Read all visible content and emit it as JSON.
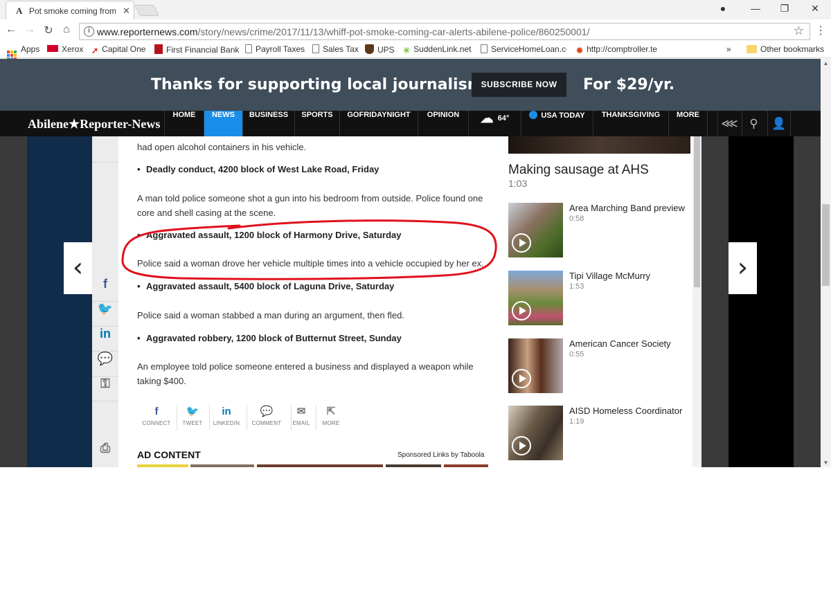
{
  "browser": {
    "tab_title": "Pot smoke coming from",
    "tab_favicon": "A",
    "url_domain": "www.reporternews.com",
    "url_path": "/story/news/crime/2017/11/13/whiff-pot-smoke-coming-car-alerts-abilene-police/860250001/",
    "bookmarks": [
      {
        "label": "Apps",
        "icon": "apps-grid-icon"
      },
      {
        "label": "Xerox",
        "icon": "xerox-icon",
        "color": "#d4002a"
      },
      {
        "label": "Capital One",
        "icon": "capital-one-icon",
        "color": "#d03027"
      },
      {
        "label": "First Financial Bank",
        "icon": "ffb-icon",
        "color": "#b5121b"
      },
      {
        "label": "Payroll Taxes",
        "icon": "page-icon"
      },
      {
        "label": "Sales Tax",
        "icon": "page-icon"
      },
      {
        "label": "UPS",
        "icon": "ups-icon",
        "color": "#5a3a1c"
      },
      {
        "label": "SuddenLink.net",
        "icon": "suddenlink-icon",
        "color": "#7fc241"
      },
      {
        "label": "ServiceHomeLoan.co",
        "icon": "page-icon"
      },
      {
        "label": "http://comptroller.te",
        "icon": "comptroller-icon",
        "color": "#d84a1b"
      }
    ],
    "overflow_label": "»",
    "other_bookmarks": "Other bookmarks"
  },
  "promo": {
    "left_text": "Thanks for supporting local journalism",
    "button": "SUBSCRIBE NOW",
    "right_text": "For $29/yr."
  },
  "site_nav": {
    "brand": "Abilene★Reporter-News",
    "items": [
      "HOME",
      "NEWS",
      "BUSINESS",
      "SPORTS",
      "GOFRIDAYNIGHT",
      "OPINION"
    ],
    "weather": "64°",
    "usa_today": "USA TODAY",
    "items2": [
      "THANKSGIVING",
      "MORE"
    ],
    "active": "NEWS",
    "accent": "#1a8de8"
  },
  "article": {
    "top_partial": "had open alcohol containers in his vehicle.",
    "entries": [
      {
        "heading": "Deadly conduct, 4200 block of West Lake Road, Friday",
        "body": "A man told police someone shot a gun into his bedroom from outside. Police found one core and shell casing at the scene."
      },
      {
        "heading": "Aggravated assault, 1200 block of Harmony Drive, Saturday",
        "body": "Police said a woman drove her vehicle multiple times into a vehicle occupied by her ex."
      },
      {
        "heading": "Aggravated assault, 5400 block of Laguna Drive, Saturday",
        "body": "Police said a woman stabbed a man during an argument, then fled."
      },
      {
        "heading": "Aggravated robbery, 1200 block of Butternut Street, Sunday",
        "body": "An employee told police someone entered a business and displayed a weapon while taking $400."
      }
    ],
    "share": [
      "CONNECT",
      "TWEET",
      "LINKEDIN",
      "COMMENT",
      "EMAIL",
      "MORE"
    ],
    "ad_title": "AD CONTENT",
    "ad_sponsor": "Sponsored Links by Taboola"
  },
  "sidebar": {
    "hero_title": "Making sausage at AHS",
    "hero_duration": "1:03",
    "videos": [
      {
        "title": "Area Marching Band preview",
        "duration": "0:58"
      },
      {
        "title": "Tipi Village McMurry",
        "duration": "1:53"
      },
      {
        "title": "American Cancer Society",
        "duration": "0:55"
      },
      {
        "title": "AISD Homeless Coordinator",
        "duration": "1:19"
      }
    ]
  },
  "annotation_color": "#e0111b"
}
